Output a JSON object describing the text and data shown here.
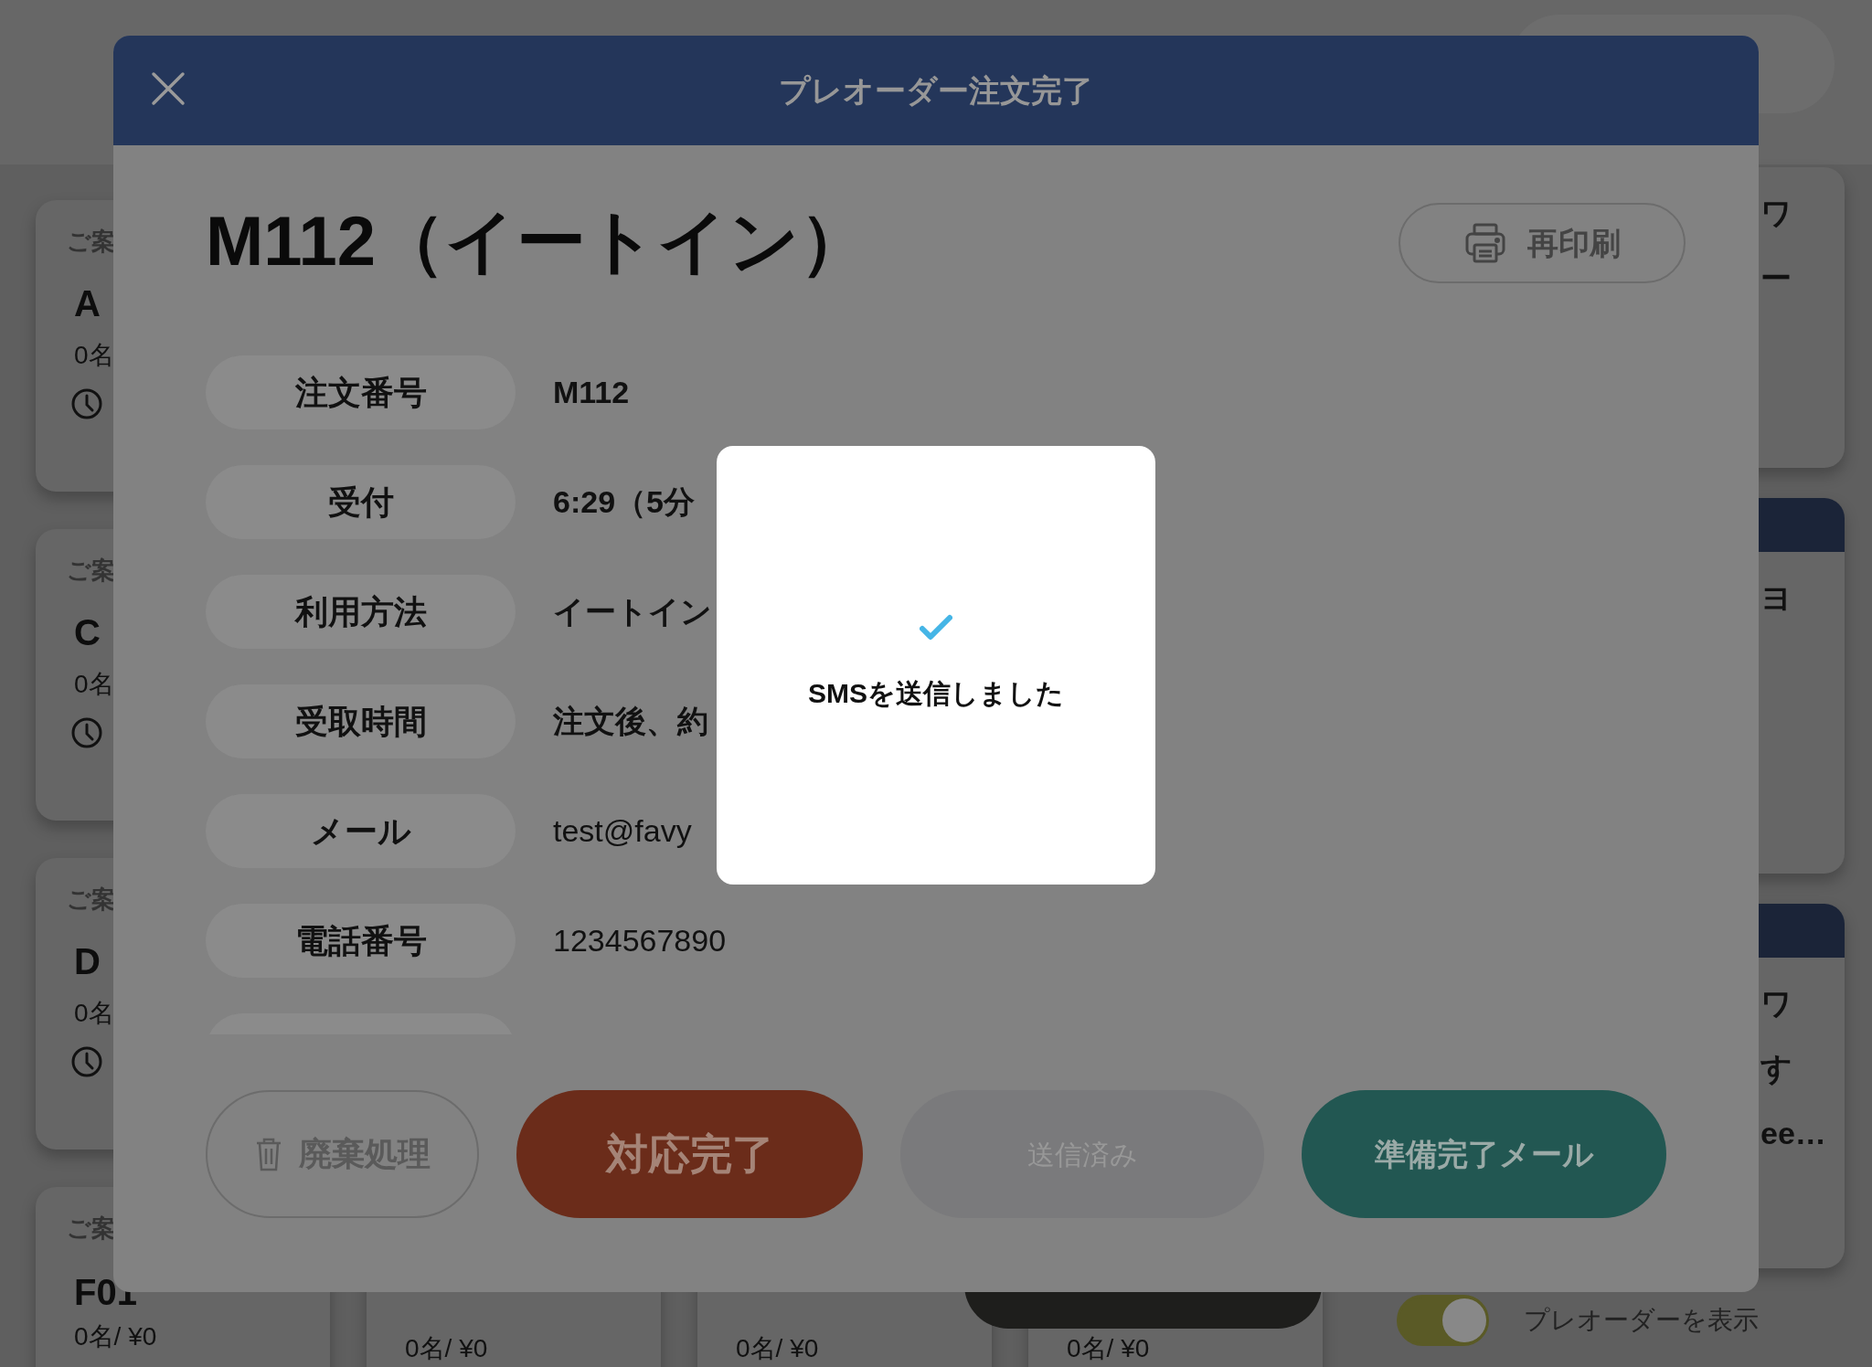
{
  "background": {
    "table_cards": [
      {
        "label": "ご案",
        "name": "A",
        "guests": "0名"
      },
      {
        "label": "ご案",
        "name": "C",
        "guests": "0名"
      },
      {
        "label": "ご案",
        "name": "D",
        "guests": "0名"
      }
    ],
    "bottom_cards": [
      {
        "kind": "table",
        "label": "ご案",
        "name": "F01",
        "guests": "0名/ ¥0"
      },
      {
        "kind": "table",
        "guests": "0名/ ¥0"
      },
      {
        "kind": "table",
        "guests": "0名/ ¥0"
      },
      {
        "kind": "action",
        "guests": "0名/ ¥0"
      }
    ],
    "side_cards": [
      {
        "header": false,
        "lines": [
          "ワ",
          "ー"
        ]
      },
      {
        "header": true,
        "lines": [
          "ヨ"
        ]
      },
      {
        "header": true,
        "lines": [
          "ワ",
          "す",
          "ee…"
        ]
      }
    ],
    "preorder_toggle": {
      "label": "プレオーダーを表示",
      "on": true
    }
  },
  "dialog": {
    "title": "プレオーダー注文完了",
    "heading": "M112（イートイン）",
    "reprint_button": "再印刷",
    "fields": [
      {
        "kind": "info",
        "label": "注文番号",
        "value": "M112"
      },
      {
        "kind": "info",
        "label": "受付",
        "value": "6:29（5分"
      },
      {
        "kind": "info",
        "label": "利用方法",
        "value": "イートイン"
      },
      {
        "kind": "info",
        "label": "受取時間",
        "value": "注文後、約"
      },
      {
        "kind": "contact",
        "label": "メール",
        "value": "test@favy"
      },
      {
        "kind": "contact",
        "label": "電話番号",
        "value": "1234567890"
      },
      {
        "kind": "cut"
      }
    ],
    "buttons": [
      {
        "kind": "discard",
        "label": "廃棄処理",
        "disabled": false
      },
      {
        "kind": "complete",
        "label": "対応完了",
        "disabled": false
      },
      {
        "kind": "sent",
        "label": "送信済み",
        "disabled": true
      },
      {
        "kind": "mail",
        "label": "準備完了メール",
        "disabled": false
      }
    ]
  },
  "toast": {
    "message": "SMSを送信しました"
  }
}
